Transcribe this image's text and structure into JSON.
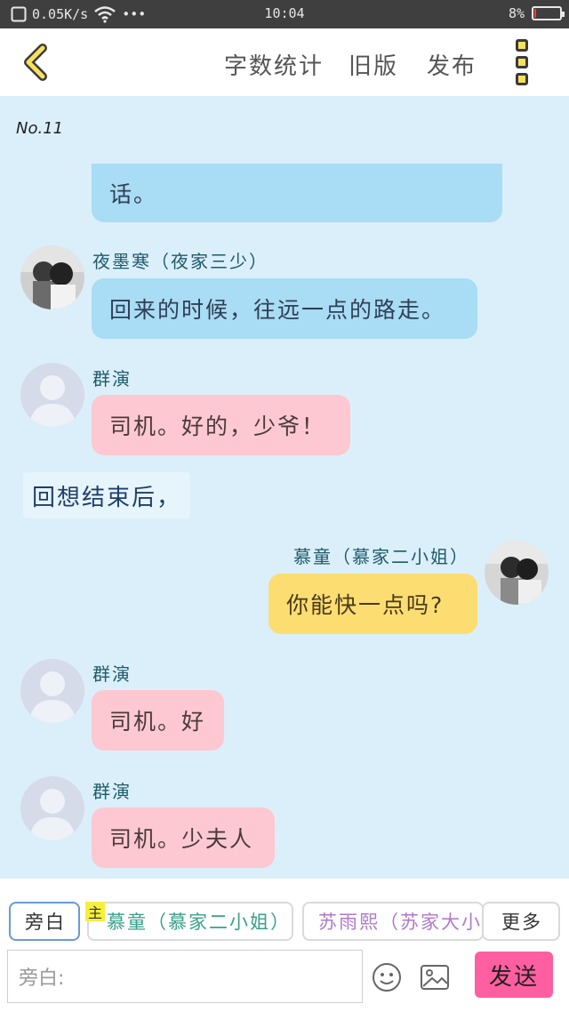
{
  "status_bar": {
    "net_speed": "0.05K/s",
    "time": "10:04",
    "battery": "8%",
    "battery_level": 0.08
  },
  "toolbar": {
    "word_count": "字数统计",
    "old_version": "旧版",
    "publish": "发布"
  },
  "chat": {
    "chapter": "No.11",
    "messages": [
      {
        "text": "话。"
      },
      {
        "speaker": "夜墨寒（夜家三少）",
        "text": "回来的时候，往远一点的路走。"
      },
      {
        "speaker": "群演",
        "text": "司机。好的，少爷！"
      },
      {
        "narration": "回想结束后，"
      },
      {
        "speaker": "慕童（慕家二小姐）",
        "text": "你能快一点吗?"
      },
      {
        "speaker": "群演",
        "text": "司机。好"
      },
      {
        "speaker": "群演",
        "text": "司机。少夫人"
      }
    ]
  },
  "bottom_bar": {
    "narrator_btn": "旁白",
    "main_badge": "主",
    "char1": "慕童（慕家二小姐）",
    "char2": "苏雨熙（苏家大小姐）",
    "more": "更多",
    "input_placeholder": "旁白:",
    "send": "发送"
  }
}
